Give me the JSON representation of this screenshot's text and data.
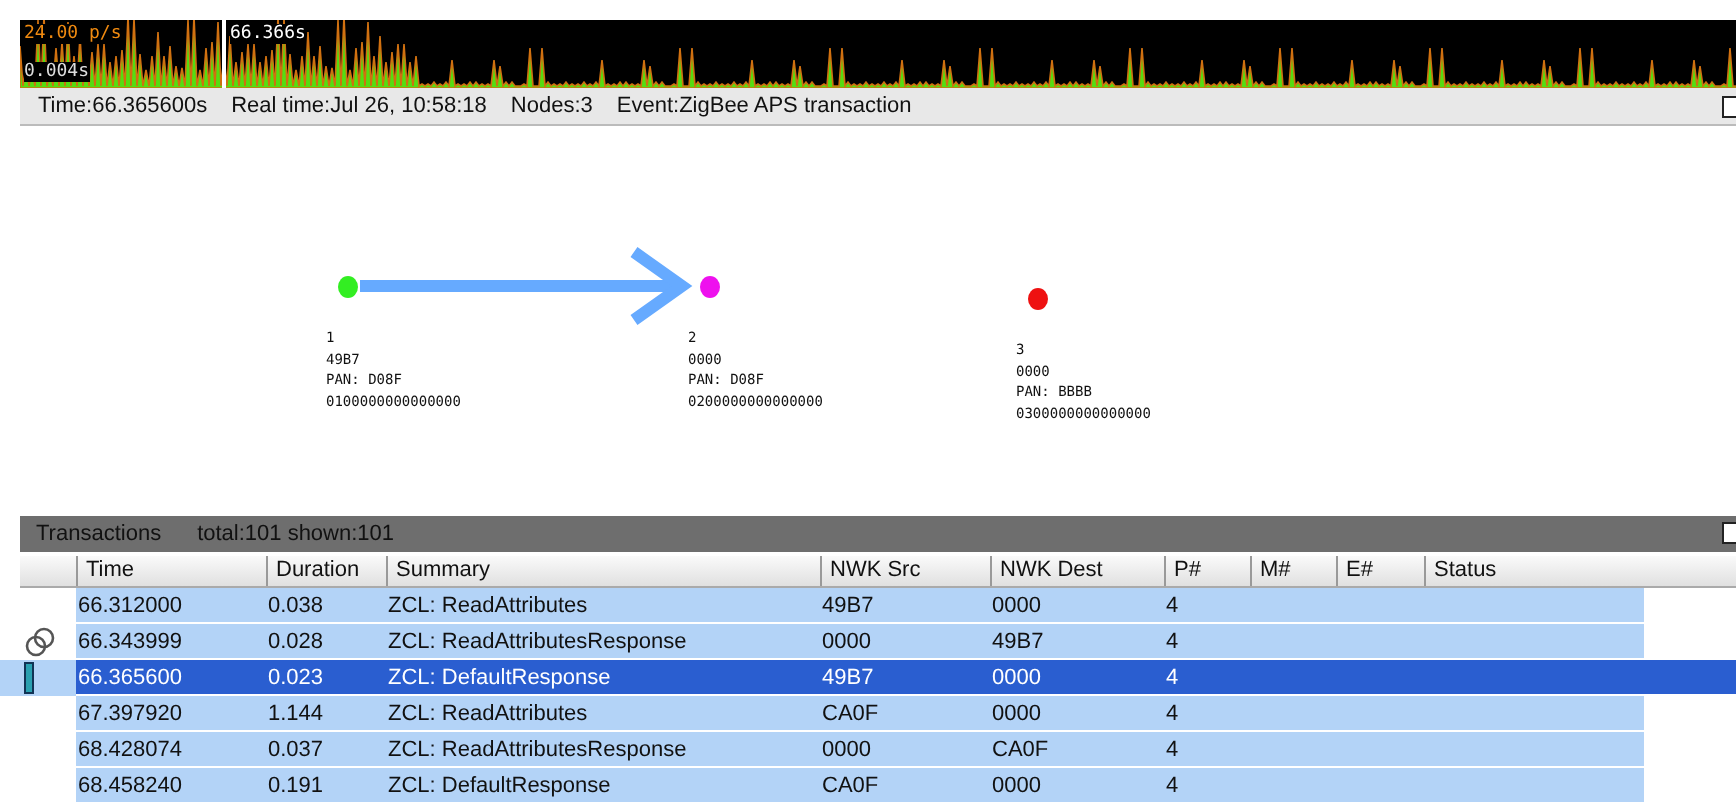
{
  "timeline": {
    "rate": "24.00 p/s",
    "scale": "0.004s",
    "cursor": "66.366s"
  },
  "info_bar": {
    "time": "Time:66.365600s",
    "real_time": "Real time:Jul 26, 10:58:18",
    "nodes": "Nodes:3",
    "event": "Event:ZigBee APS transaction"
  },
  "nodes": [
    {
      "label": "1",
      "address": "49B7",
      "pan": "PAN: D08F",
      "extended": "0100000000000000",
      "color": "#33ee22"
    },
    {
      "label": "2",
      "address": "0000",
      "pan": "PAN: D08F",
      "extended": "0200000000000000",
      "color": "#ee11ee"
    },
    {
      "label": "3",
      "address": "0000",
      "pan": "PAN: BBBB",
      "extended": "0300000000000000",
      "color": "#ee1111"
    }
  ],
  "transactions": {
    "title": "Transactions",
    "counts": "total:101 shown:101",
    "columns": [
      "Time",
      "Duration",
      "Summary",
      "NWK Src",
      "NWK Dest",
      "P#",
      "M#",
      "E#",
      "Status"
    ],
    "rows": [
      {
        "cells": [
          "66.312000",
          "0.038",
          "ZCL: ReadAttributes",
          "49B7",
          "0000",
          "4"
        ],
        "selected": false,
        "linked": false
      },
      {
        "cells": [
          "66.343999",
          "0.028",
          "ZCL: ReadAttributesResponse",
          "0000",
          "49B7",
          "4"
        ],
        "selected": false,
        "linked": true
      },
      {
        "cells": [
          "66.365600",
          "0.023",
          "ZCL: DefaultResponse",
          "49B7",
          "0000",
          "4"
        ],
        "selected": true,
        "linked": false
      },
      {
        "cells": [
          "67.397920",
          "1.144",
          "ZCL: ReadAttributes",
          "CA0F",
          "0000",
          "4"
        ],
        "selected": false,
        "linked": false
      },
      {
        "cells": [
          "68.428074",
          "0.037",
          "ZCL: ReadAttributesResponse",
          "0000",
          "CA0F",
          "4"
        ],
        "selected": false,
        "linked": false
      },
      {
        "cells": [
          "68.458240",
          "0.191",
          "ZCL: DefaultResponse",
          "CA0F",
          "0000",
          "4"
        ],
        "selected": false,
        "linked": false
      }
    ]
  }
}
